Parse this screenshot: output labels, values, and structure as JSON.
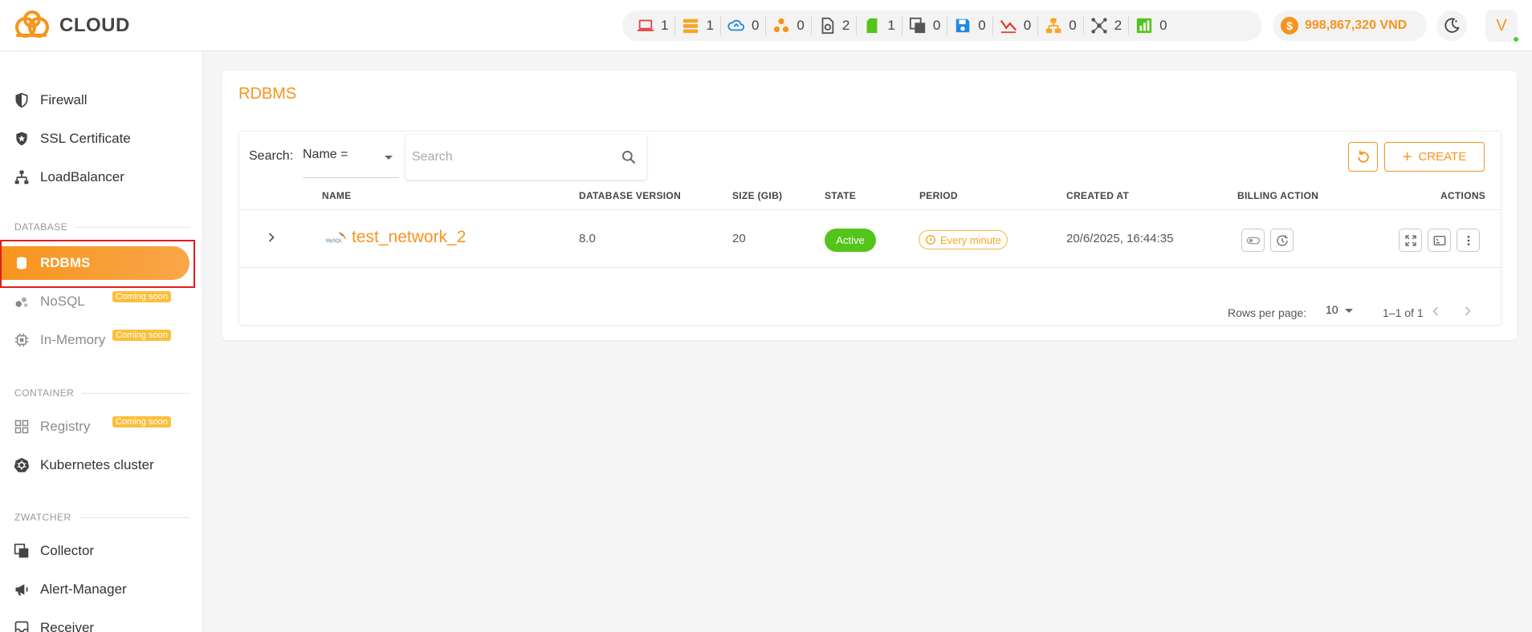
{
  "brand": {
    "name": "CLOUD",
    "accent": "#f7941d"
  },
  "counters": [
    {
      "icon": "laptop-icon",
      "value": "1"
    },
    {
      "icon": "server-icon",
      "value": "1"
    },
    {
      "icon": "cloud-sync-icon",
      "value": "0"
    },
    {
      "icon": "cluster-icon",
      "value": "0"
    },
    {
      "icon": "snapshot-icon",
      "value": "2"
    },
    {
      "icon": "sd-card-icon",
      "value": "1"
    },
    {
      "icon": "copy-icon",
      "value": "0"
    },
    {
      "icon": "floppy-disk-icon",
      "value": "0"
    },
    {
      "icon": "line-chart-icon",
      "value": "0"
    },
    {
      "icon": "network-tree-icon",
      "value": "0"
    },
    {
      "icon": "nodes-icon",
      "value": "2"
    },
    {
      "icon": "bar-chart-icon",
      "value": "0"
    }
  ],
  "balance": {
    "symbol": "$",
    "text": "998,867,320 VND"
  },
  "user": {
    "initial": "V"
  },
  "sidebar": {
    "items": [
      {
        "label": "Firewall",
        "icon": "shield-icon"
      },
      {
        "label": "SSL Certificate",
        "icon": "badge-shield-icon"
      },
      {
        "label": "LoadBalancer",
        "icon": "sitemap-icon"
      },
      {
        "label": "RDBMS",
        "icon": "database-icon"
      },
      {
        "label": "NoSQL",
        "icon": "nosql-icon"
      },
      {
        "label": "In-Memory",
        "icon": "chip-icon"
      },
      {
        "label": "Registry",
        "icon": "grid-icon"
      },
      {
        "label": "Kubernetes cluster",
        "icon": "kubernetes-icon"
      },
      {
        "label": "Collector",
        "icon": "collector-icon"
      },
      {
        "label": "Alert-Manager",
        "icon": "megaphone-icon"
      },
      {
        "label": "Receiver",
        "icon": "receiver-icon"
      }
    ],
    "sections": {
      "database": "DATABASE",
      "container": "CONTAINER",
      "zwatcher": "ZWATCHER"
    },
    "coming_soon": "Coming soon"
  },
  "main": {
    "title": "RDBMS",
    "search_label": "Search:",
    "search_field": "Name =",
    "search_placeholder": "Search",
    "create_label": "CREATE",
    "columns": [
      "NAME",
      "DATABASE VERSION",
      "SIZE (GIB)",
      "STATE",
      "PERIOD",
      "CREATED AT",
      "BILLING ACTION",
      "ACTIONS"
    ],
    "rows": [
      {
        "logo_text": "MySQL",
        "name": "test_network_2",
        "version": "8.0",
        "size": "20",
        "state": "Active",
        "period": "Every minute",
        "created_at": "20/6/2025, 16:44:35"
      }
    ],
    "pagination": {
      "rows_label": "Rows per page:",
      "rows_value": "10",
      "range": "1–1 of 1"
    }
  }
}
